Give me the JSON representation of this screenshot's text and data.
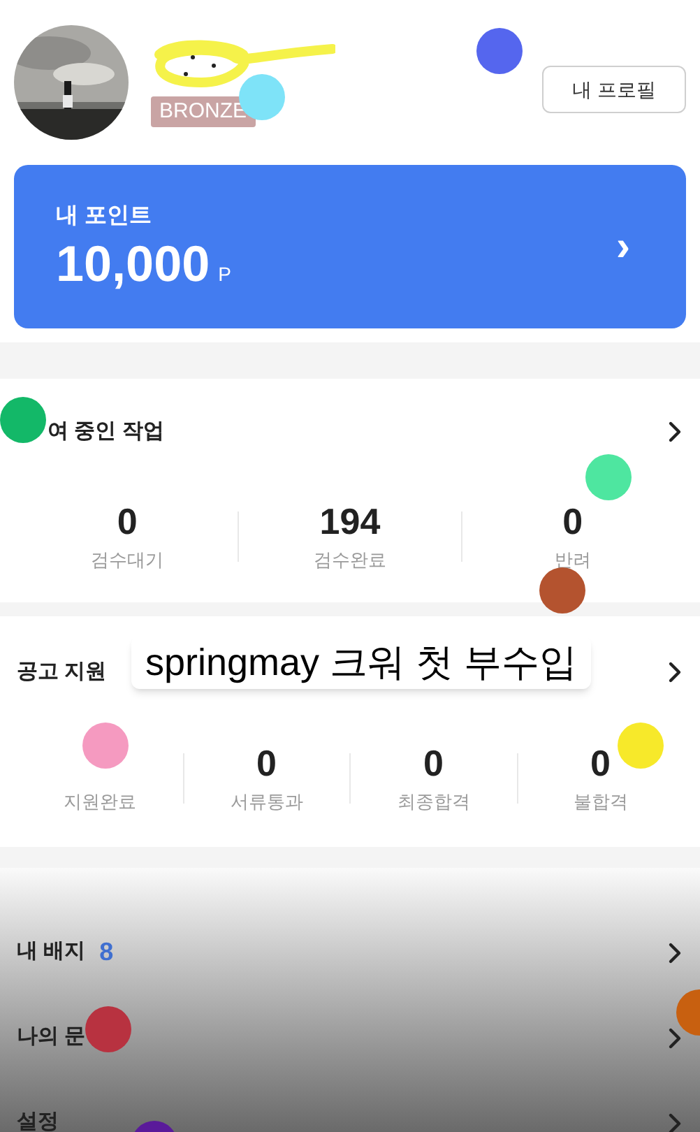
{
  "profile": {
    "tier": "BRONZE",
    "profile_button": "내 프로필"
  },
  "points": {
    "label": "내 포인트",
    "value": "10,000",
    "unit": "P",
    "chevron": "›"
  },
  "sections": [
    {
      "title": "여 중인 작업",
      "stats": [
        {
          "value": "0",
          "label": "검수대기"
        },
        {
          "value": "194",
          "label": "검수완료"
        },
        {
          "value": "0",
          "label": "반려"
        }
      ]
    },
    {
      "title": "공고 지원",
      "stats": [
        {
          "label": "지원완료"
        },
        {
          "value": "0",
          "label": "서류통과"
        },
        {
          "value": "0",
          "label": "최종합격"
        },
        {
          "value": "0",
          "label": "불합격"
        }
      ]
    }
  ],
  "menu": [
    {
      "label": "내 배지",
      "count": "8"
    },
    {
      "label": "나의 문"
    },
    {
      "label": "설정"
    }
  ],
  "caption": "springmay 크워 첫 부수입",
  "markers": [
    {
      "color": "#5566ee"
    },
    {
      "color": "#7ee3f8"
    },
    {
      "color": "#13b868"
    },
    {
      "color": "#4ee6a0"
    },
    {
      "color": "#b4532f"
    },
    {
      "color": "#f59ac0"
    },
    {
      "color": "#f7e92a"
    },
    {
      "color": "#b83240"
    },
    {
      "color": "#c86010"
    },
    {
      "color": "#5a1a9a"
    }
  ]
}
